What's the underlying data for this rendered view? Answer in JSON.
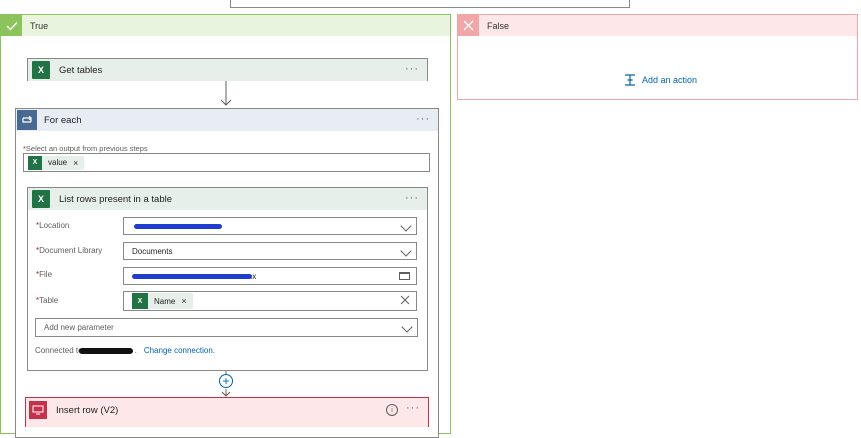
{
  "colors": {
    "true_accent": "#8cc35b",
    "false_accent": "#f1a7a7",
    "excel_green": "#217346",
    "foreach_blue": "#486991",
    "insert_red": "#c4314b",
    "link_blue": "#0063b1"
  },
  "branches": {
    "true": {
      "label": "True",
      "icon": "check-icon"
    },
    "false": {
      "label": "False",
      "icon": "close-icon",
      "add_action": "Add an action"
    }
  },
  "get_tables": {
    "title": "Get tables",
    "menu": "···"
  },
  "for_each": {
    "title": "For each",
    "menu": "···",
    "field_label": "Select an output from previous steps",
    "token": "value"
  },
  "list_rows": {
    "title": "List rows present in a table",
    "menu": "···",
    "fields": [
      {
        "label": "Location",
        "value": ""
      },
      {
        "label": "Document Library",
        "value": "Documents"
      },
      {
        "label": "File",
        "value": ".x"
      },
      {
        "label": "Table",
        "token": "Name"
      }
    ],
    "add_param": "Add new parameter",
    "connected_prefix": "Connected to",
    "connected_suffix": ".",
    "change_connection": "Change connection."
  },
  "insert_row": {
    "title": "Insert row (V2)",
    "menu": "···",
    "info_icon": "info-icon"
  }
}
